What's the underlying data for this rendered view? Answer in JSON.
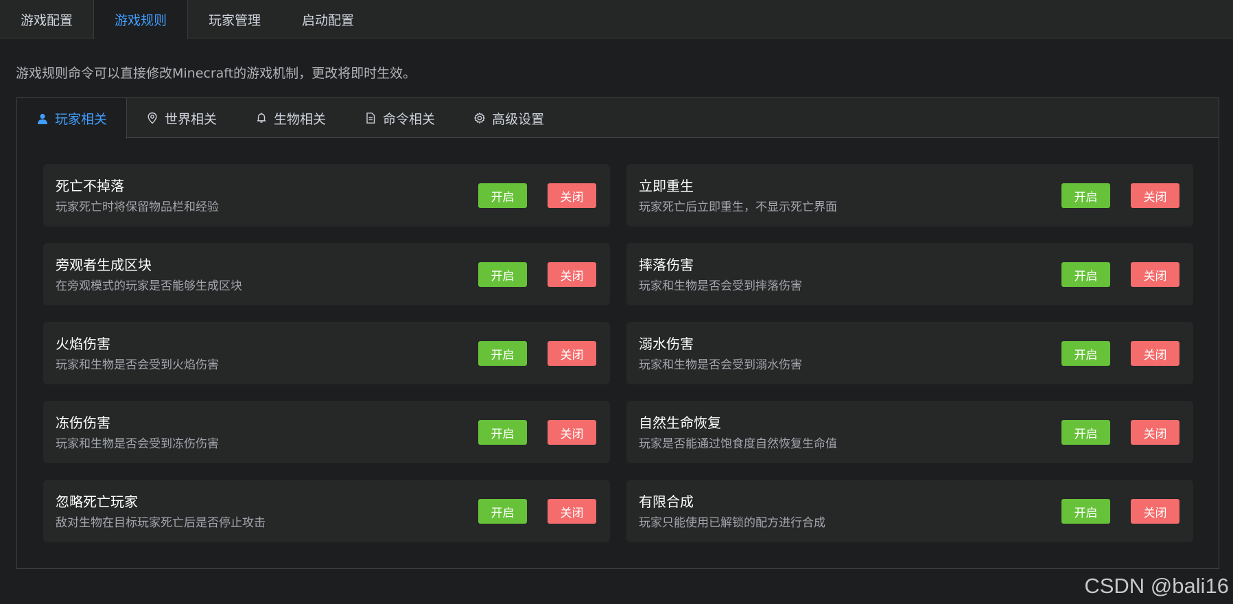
{
  "top_tabs": [
    {
      "label": "游戏配置"
    },
    {
      "label": "游戏规则"
    },
    {
      "label": "玩家管理"
    },
    {
      "label": "启动配置"
    }
  ],
  "active_top_tab": 1,
  "intro_text": "游戏规则命令可以直接修改Minecraft的游戏机制，更改将即时生效。",
  "sub_tabs": [
    {
      "label": "玩家相关",
      "icon": "user-icon"
    },
    {
      "label": "世界相关",
      "icon": "location-pin-icon"
    },
    {
      "label": "生物相关",
      "icon": "bell-icon"
    },
    {
      "label": "命令相关",
      "icon": "document-icon"
    },
    {
      "label": "高级设置",
      "icon": "gear-icon"
    }
  ],
  "active_sub_tab": 0,
  "buttons": {
    "on_label": "开启",
    "off_label": "关闭"
  },
  "rules": [
    {
      "title": "死亡不掉落",
      "desc": "玩家死亡时将保留物品栏和经验"
    },
    {
      "title": "立即重生",
      "desc": "玩家死亡后立即重生，不显示死亡界面"
    },
    {
      "title": "旁观者生成区块",
      "desc": "在旁观模式的玩家是否能够生成区块"
    },
    {
      "title": "摔落伤害",
      "desc": "玩家和生物是否会受到摔落伤害"
    },
    {
      "title": "火焰伤害",
      "desc": "玩家和生物是否会受到火焰伤害"
    },
    {
      "title": "溺水伤害",
      "desc": "玩家和生物是否会受到溺水伤害"
    },
    {
      "title": "冻伤伤害",
      "desc": "玩家和生物是否会受到冻伤伤害"
    },
    {
      "title": "自然生命恢复",
      "desc": "玩家是否能通过饱食度自然恢复生命值"
    },
    {
      "title": "忽略死亡玩家",
      "desc": "敌对生物在目标玩家死亡后是否停止攻击"
    },
    {
      "title": "有限合成",
      "desc": "玩家只能使用已解锁的配方进行合成"
    }
  ],
  "colors": {
    "accent": "#409eff",
    "enable_button": "#67c23a",
    "disable_button": "#f56c6c"
  },
  "watermark": "CSDN @bali16"
}
